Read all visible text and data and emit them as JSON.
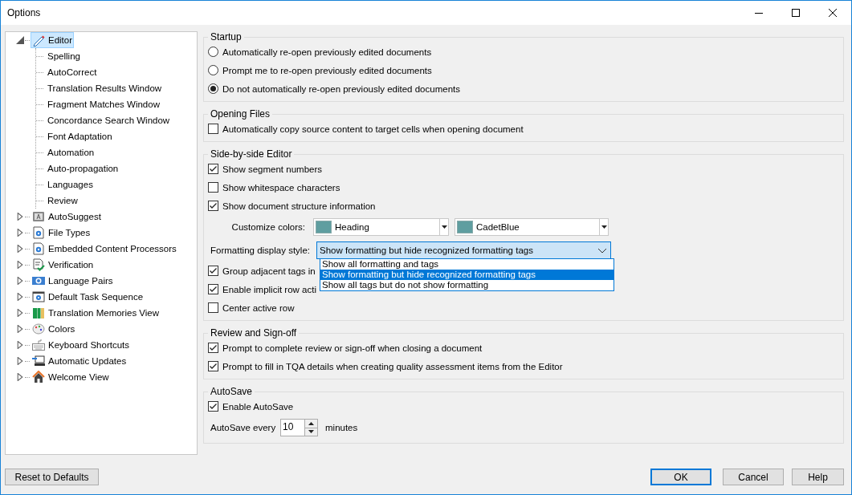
{
  "window": {
    "title": "Options"
  },
  "tree": [
    {
      "label": "Editor",
      "expanded": true,
      "selected": true,
      "children": [
        {
          "label": "Spelling",
          "selected": false
        },
        {
          "label": "AutoCorrect",
          "selected": false
        },
        {
          "label": "Translation Results Window",
          "selected": false
        },
        {
          "label": "Fragment Matches Window",
          "selected": false
        },
        {
          "label": "Concordance Search Window",
          "selected": false
        },
        {
          "label": "Font Adaptation",
          "selected": false
        },
        {
          "label": "Automation",
          "selected": false
        },
        {
          "label": "Auto-propagation",
          "selected": false
        },
        {
          "label": "Languages",
          "selected": false
        },
        {
          "label": "Review",
          "selected": false
        }
      ]
    },
    {
      "label": "AutoSuggest",
      "expanded": false,
      "selected": false
    },
    {
      "label": "File Types",
      "expanded": false,
      "selected": false
    },
    {
      "label": "Embedded Content Processors",
      "expanded": false,
      "selected": false
    },
    {
      "label": "Verification",
      "expanded": false,
      "selected": false
    },
    {
      "label": "Language Pairs",
      "expanded": false,
      "selected": false
    },
    {
      "label": "Default Task Sequence",
      "expanded": false,
      "selected": false
    },
    {
      "label": "Translation Memories View",
      "expanded": false,
      "selected": false
    },
    {
      "label": "Colors",
      "expanded": false,
      "selected": false
    },
    {
      "label": "Keyboard Shortcuts",
      "expanded": false,
      "selected": false
    },
    {
      "label": "Automatic Updates",
      "expanded": false,
      "selected": false
    },
    {
      "label": "Welcome View",
      "expanded": false,
      "selected": false
    }
  ],
  "groups": [
    {
      "title": "Startup",
      "items": [
        {
          "kind": "radio",
          "label": "Automatically re-open previously edited documents",
          "selected": false
        },
        {
          "kind": "radio",
          "label": "Prompt me to re-open previously edited documents",
          "selected": false
        },
        {
          "kind": "radio",
          "label": "Do not automatically re-open previously edited documents",
          "selected": true
        }
      ]
    },
    {
      "title": "Opening Files",
      "items": [
        {
          "kind": "checkbox",
          "label": "Automatically copy source content to target cells when opening document",
          "checked": false
        }
      ]
    },
    {
      "title": "Side-by-side Editor",
      "items": [
        {
          "kind": "checkbox",
          "label": "Show segment numbers",
          "checked": true
        },
        {
          "kind": "checkbox",
          "label": "Show whitespace characters",
          "checked": false
        },
        {
          "kind": "checkbox",
          "label": "Show document structure information",
          "checked": true
        },
        {
          "kind": "colors",
          "label": "Customize colors:",
          "combos": [
            {
              "value": "Heading",
              "color": "#5f9ea0"
            },
            {
              "value": "CadetBlue",
              "color": "#5f9ea0"
            }
          ]
        },
        {
          "kind": "dropdown",
          "label": "Formatting display style:",
          "value": "Show formatting but hide recognized formatting tags",
          "open": true,
          "options": [
            {
              "label": "Show all formatting and tags",
              "selected": false
            },
            {
              "label": "Show formatting but hide recognized formatting tags",
              "selected": true
            },
            {
              "label": "Show all tags but do not show formatting",
              "selected": false
            }
          ]
        },
        {
          "kind": "checkbox",
          "label": "Group adjacent tags in",
          "checked": true
        },
        {
          "kind": "checkbox",
          "label": "Enable implicit row acti",
          "checked": true
        },
        {
          "kind": "checkbox",
          "label": "Center active row",
          "checked": false
        }
      ]
    },
    {
      "title": "Review and Sign-off",
      "items": [
        {
          "kind": "checkbox",
          "label": "Prompt to complete review or sign-off when closing a document",
          "checked": true
        },
        {
          "kind": "checkbox",
          "label": "Prompt to fill in TQA details when creating quality assessment items from the Editor",
          "checked": true
        }
      ]
    },
    {
      "title": "AutoSave",
      "items": [
        {
          "kind": "checkbox",
          "label": "Enable AutoSave",
          "checked": true
        },
        {
          "kind": "spinner",
          "label": "AutoSave every",
          "value": "10",
          "unit": "minutes"
        }
      ]
    }
  ],
  "footer": {
    "left_buttons": [
      {
        "label": "Reset to Defaults",
        "default": false
      }
    ],
    "right_buttons": [
      {
        "label": "OK",
        "default": true
      },
      {
        "label": "Cancel",
        "default": false
      },
      {
        "label": "Help",
        "default": false
      }
    ]
  }
}
